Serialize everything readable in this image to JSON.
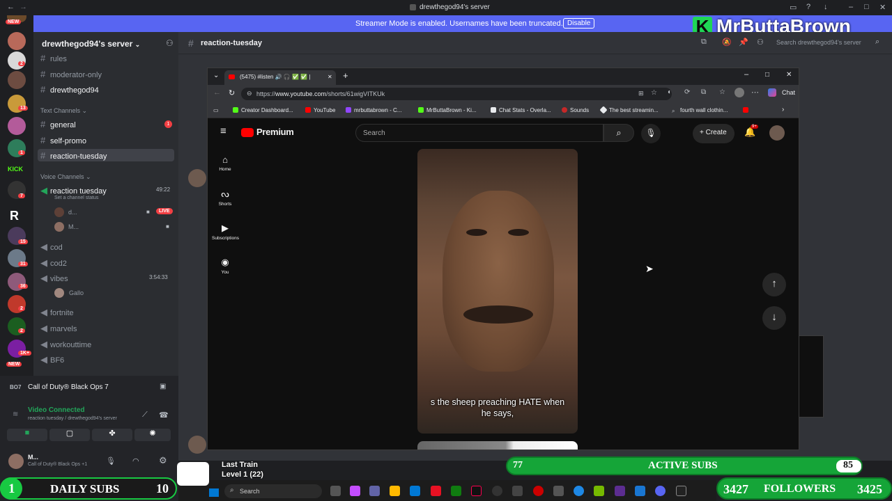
{
  "window": {
    "title": "drewthegod94's server"
  },
  "banner": {
    "message": "Streamer Mode is enabled. Usernames have been truncated.",
    "disable_label": "Disable"
  },
  "overlay_logo": "MrButtaBrown",
  "server": {
    "name": "drewthegod94's server"
  },
  "channel_header": {
    "name": "reaction-tuesday",
    "search_placeholder": "Search drewthegod94's server"
  },
  "sidebar": {
    "top_channels": [
      "rules",
      "moderator-only",
      "drewthegod94"
    ],
    "text_category": "Text Channels",
    "text_channels": [
      "general",
      "self-promo",
      "reaction-tuesday"
    ],
    "general_badge": "1",
    "voice_category": "Voice Channels",
    "voice_active": {
      "name": "reaction tuesday",
      "timer": "49:22",
      "status": "Set a channel status"
    },
    "voice_users": [
      "d...",
      "M..."
    ],
    "live_label": "LIVE",
    "voice_channels": [
      "cod",
      "cod2",
      "vibes",
      "fortnite",
      "marvels",
      "workouttime",
      "BF6"
    ],
    "vibes_timer": "3:54:33",
    "vibes_user": "Gallo"
  },
  "game_activity": "Call of Duty® Black Ops 7",
  "voice_status": {
    "title": "Video Connected",
    "subtitle": "reaction tuesday / drewthegod94's server"
  },
  "user_panel": {
    "name": "M...",
    "activity": "Call of Duty® Black Ops +1"
  },
  "guild_badges": [
    "NEW",
    "2",
    "13",
    "1",
    "7",
    "15",
    "31",
    "36",
    "2",
    "2",
    "1K+",
    "NEW"
  ],
  "browser": {
    "tab_title": "(5475) #listen 🔊 🎧 ✅ ✅ |",
    "url_prefix": "https://",
    "url_host": "www.youtube.com",
    "url_path": "/shorts/61wigVITKUk",
    "chat_label": "Chat",
    "bookmarks": [
      "Creator Dashboard...",
      "YouTube",
      "mrbuttabrown - C...",
      "MrButtaBrown - Ki...",
      "Chat Stats - Overla...",
      "Sounds",
      "The best streamin...",
      "fourth wall clothin..."
    ]
  },
  "youtube": {
    "brand": "Premium",
    "search_placeholder": "Search",
    "create_label": "Create",
    "notif_badge": "9+",
    "nav": [
      "Home",
      "Shorts",
      "Subscriptions",
      "You"
    ],
    "caption_line1": "s the sheep preaching HATE when",
    "caption_line2": "he says,"
  },
  "stream_overlay": {
    "daily_subs": {
      "left": "1",
      "label": "DAILY SUBS",
      "right": "10"
    },
    "active_subs": {
      "left": "77",
      "label": "ACTIVE SUBS",
      "right": "85"
    },
    "followers": {
      "left": "3427",
      "label": "FOLLOWERS",
      "right": "3425"
    },
    "music": {
      "title": "Last Train",
      "level": "Level 1  (22)"
    }
  },
  "taskbar": {
    "search_label": "Search"
  },
  "colors": {
    "discord_bg": "#313338",
    "accent": "#5865f2",
    "green": "#15a538",
    "live": "#f23f43"
  }
}
